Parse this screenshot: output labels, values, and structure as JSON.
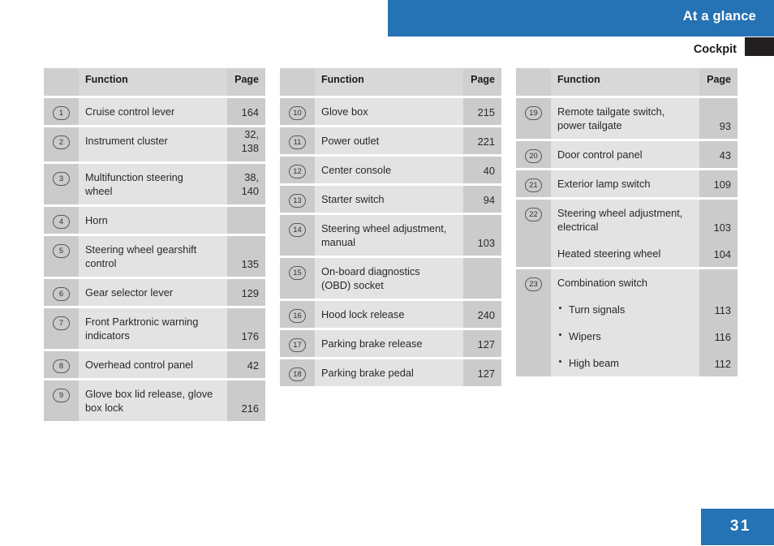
{
  "header": {
    "chapter_title": "At a glance",
    "section_title": "Cockpit",
    "marker_icon": "section-tab-marker"
  },
  "footer": {
    "page_number": "31"
  },
  "columns": {
    "function": "Function",
    "page": "Page"
  },
  "tables": [
    {
      "id": "table-1",
      "rows": [
        {
          "num": "1",
          "function": "Cruise control lever",
          "page": "164"
        },
        {
          "num": "2",
          "function": "Instrument cluster",
          "page_line1": "32,",
          "page_line2": "138"
        },
        {
          "num": "3",
          "function_line1": "Multifunction steering",
          "function_line2": "wheel",
          "page_line1": "38,",
          "page_line2": "140"
        },
        {
          "num": "4",
          "function": "Horn",
          "page": ""
        },
        {
          "num": "5",
          "function_line1": "Steering wheel gearshift",
          "function_line2": "control",
          "page": "135"
        },
        {
          "num": "6",
          "function": "Gear selector lever",
          "page": "129"
        },
        {
          "num": "7",
          "function_line1": "Front Parktronic warning",
          "function_line2": "indicators",
          "page": "176"
        },
        {
          "num": "8",
          "function": "Overhead control panel",
          "page": "42"
        },
        {
          "num": "9",
          "function_line1": "Glove box lid release, glove",
          "function_line2": "box lock",
          "page": "216"
        }
      ]
    },
    {
      "id": "table-2",
      "rows": [
        {
          "num": "10",
          "function": "Glove box",
          "page": "215"
        },
        {
          "num": "11",
          "function": "Power outlet",
          "page": "221"
        },
        {
          "num": "12",
          "function": "Center console",
          "page": "40"
        },
        {
          "num": "13",
          "function": "Starter switch",
          "page": "94"
        },
        {
          "num": "14",
          "function_line1": "Steering wheel adjustment,",
          "function_line2": "manual",
          "page": "103"
        },
        {
          "num": "15",
          "function_line1": "On-board diagnostics",
          "function_line2": "(OBD) socket",
          "page": ""
        },
        {
          "num": "16",
          "function": "Hood lock release",
          "page": "240"
        },
        {
          "num": "17",
          "function": "Parking brake release",
          "page": "127"
        },
        {
          "num": "18",
          "function": "Parking brake pedal",
          "page": "127"
        }
      ]
    },
    {
      "id": "table-3",
      "rows": [
        {
          "num": "19",
          "function_line1": "Remote tailgate switch,",
          "function_line2": "power tailgate",
          "page": "93"
        },
        {
          "num": "20",
          "function": "Door control panel",
          "page": "43"
        },
        {
          "num": "21",
          "function": "Exterior lamp switch",
          "page": "109"
        },
        {
          "num": "22",
          "group": [
            {
              "function_line1": "Steering wheel adjustment,",
              "function_line2": "electrical",
              "page": "103"
            },
            {
              "function": "Heated steering wheel",
              "page": "104"
            }
          ]
        },
        {
          "num": "23",
          "group": [
            {
              "function": "Combination switch",
              "page": ""
            },
            {
              "function": "Turn signals",
              "page": "113",
              "bullet": true
            },
            {
              "function": "Wipers",
              "page": "116",
              "bullet": true
            },
            {
              "function": "High beam",
              "page": "112",
              "bullet": true
            }
          ]
        }
      ]
    }
  ],
  "colors": {
    "brand_blue": "#2572b4",
    "marker_black": "#231f20",
    "cell_dark": "#cbcbcb",
    "cell_light": "#e3e3e3",
    "header_cell": "#cfcfcf"
  }
}
